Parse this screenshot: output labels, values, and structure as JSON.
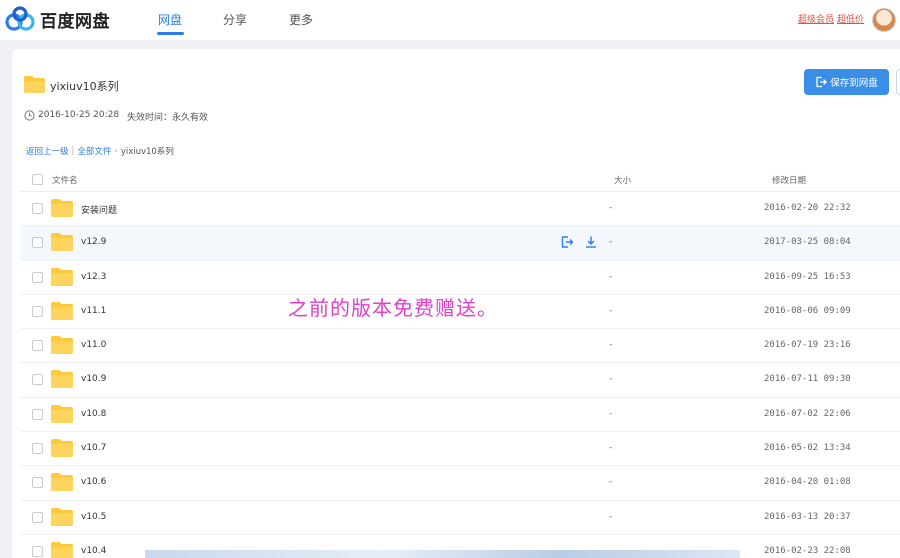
{
  "app": {
    "logo_text": "百度网盘"
  },
  "nav": {
    "items": [
      {
        "label": "网盘",
        "active": true
      },
      {
        "label": "分享",
        "active": false
      },
      {
        "label": "更多",
        "active": false
      }
    ],
    "vip_links": [
      "超级会员",
      "超低价"
    ]
  },
  "share": {
    "title": "yixiuv10系列",
    "date": "2016-10-25 20:28",
    "expire": "失效时间：永久有效",
    "save_label": "保存到网盘"
  },
  "breadcrumb": {
    "back": "返回上一级",
    "all_files": "全部文件",
    "current": "yixiuv10系列"
  },
  "table": {
    "columns": {
      "name": "文件名",
      "size": "大小",
      "date": "修改日期"
    },
    "rows": [
      {
        "name": "安装问题",
        "size": "-",
        "date": "2016-02-20 22:32"
      },
      {
        "name": "v12.9",
        "size": "-",
        "date": "2017-03-25 08:04"
      },
      {
        "name": "v12.3",
        "size": "-",
        "date": "2016-09-25 16:53"
      },
      {
        "name": "v11.1",
        "size": "-",
        "date": "2016-08-06 09:09"
      },
      {
        "name": "v11.0",
        "size": "-",
        "date": "2016-07-19 23:16"
      },
      {
        "name": "v10.9",
        "size": "-",
        "date": "2016-07-11 09:30"
      },
      {
        "name": "v10.8",
        "size": "-",
        "date": "2016-07-02 22:06"
      },
      {
        "name": "v10.7",
        "size": "-",
        "date": "2016-05-02 13:34"
      },
      {
        "name": "v10.6",
        "size": "-",
        "date": "2016-04-20 01:08"
      },
      {
        "name": "v10.5",
        "size": "-",
        "date": "2016-03-13 20:37"
      },
      {
        "name": "v10.4",
        "size": "-",
        "date": "2016-02-23 22:08"
      }
    ]
  },
  "overlay_text": "之前的版本免费赠送。",
  "colors": {
    "accent": "#2b7de9",
    "overlay": "#e040c8",
    "folder": "#ffc93c"
  }
}
